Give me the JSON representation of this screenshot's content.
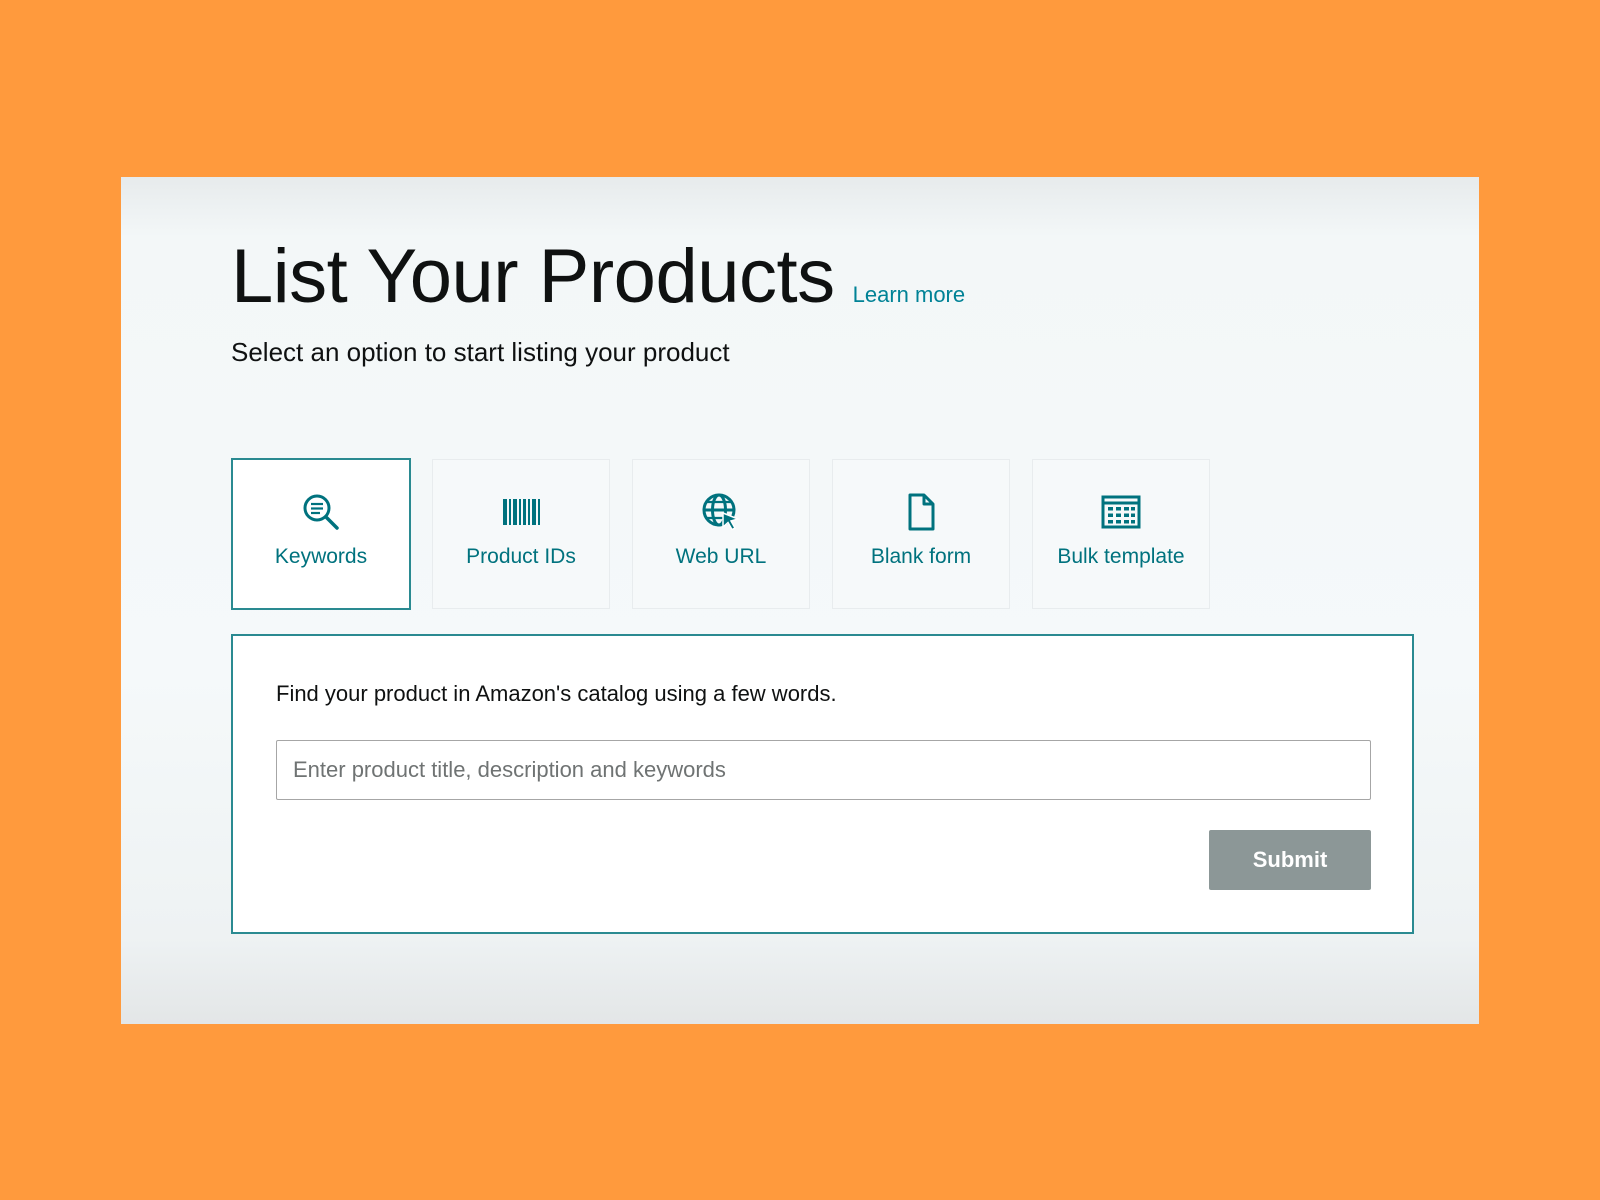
{
  "header": {
    "title": "List Your Products",
    "learn_more": "Learn more",
    "subtitle": "Select an option to start listing your product"
  },
  "tabs": [
    {
      "label": "Keywords",
      "icon": "search-icon",
      "active": true
    },
    {
      "label": "Product IDs",
      "icon": "barcode-icon",
      "active": false
    },
    {
      "label": "Web URL",
      "icon": "globe-cursor-icon",
      "active": false
    },
    {
      "label": "Blank form",
      "icon": "document-icon",
      "active": false
    },
    {
      "label": "Bulk template",
      "icon": "spreadsheet-icon",
      "active": false
    }
  ],
  "panel": {
    "instruction": "Find your product in Amazon's catalog using a few words.",
    "search_placeholder": "Enter product title, description and keywords",
    "search_value": "",
    "submit_label": "Submit"
  },
  "colors": {
    "background": "#FF9A3D",
    "accent": "#008296",
    "active_border": "#2a8a91",
    "submit_disabled": "#8c9797"
  }
}
